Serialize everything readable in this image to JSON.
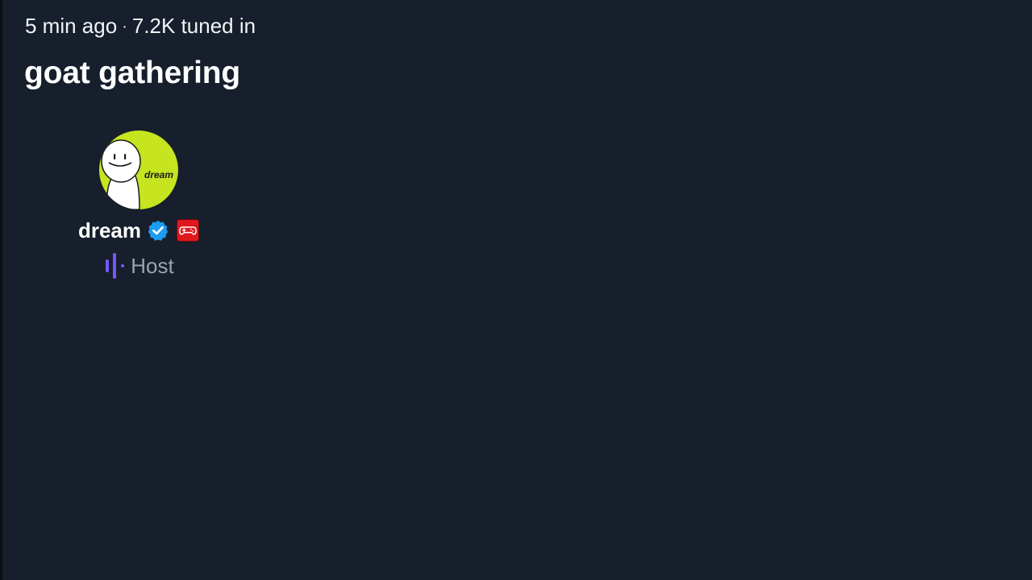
{
  "space": {
    "time_ago": "5 min ago",
    "separator": "·",
    "listeners": "7.2K tuned in",
    "title": "goat gathering"
  },
  "host": {
    "name": "dream",
    "role": "Host",
    "avatar_text": "dream",
    "icons": {
      "verified": "verified-badge-icon",
      "affiliate": "gamepad-icon",
      "speaking": "speaking-bars-icon"
    }
  },
  "colors": {
    "background": "#161f2b",
    "verified": "#1d9bf0",
    "affiliate_badge": "#e0181d",
    "speaking": "#7856ff",
    "avatar_bg": "#c6e41f",
    "role_text": "#9aa4ae"
  }
}
